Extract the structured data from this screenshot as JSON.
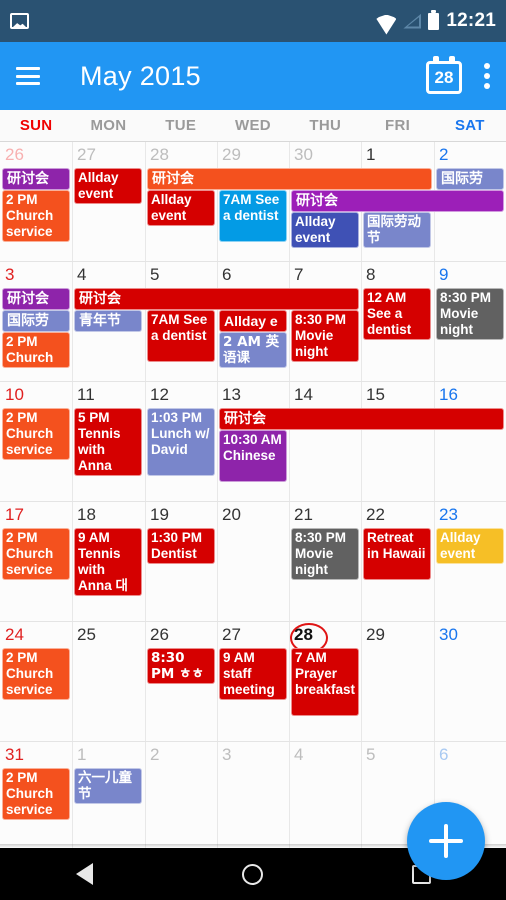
{
  "status_bar": {
    "time": "12:21",
    "icons": [
      "photo-icon",
      "wifi-icon",
      "signal-icon",
      "battery-icon"
    ]
  },
  "app_bar": {
    "menu_icon": "hamburger-menu-icon",
    "title": "May 2015",
    "today_icon_day": "28",
    "overflow_icon": "overflow-menu-icon",
    "accent_color": "#2196f3"
  },
  "weekdays": [
    {
      "label": "SUN",
      "cls": "sun"
    },
    {
      "label": "MON",
      "cls": ""
    },
    {
      "label": "TUE",
      "cls": ""
    },
    {
      "label": "WED",
      "cls": ""
    },
    {
      "label": "THU",
      "cls": ""
    },
    {
      "label": "FRI",
      "cls": ""
    },
    {
      "label": "SAT",
      "cls": "sat"
    }
  ],
  "today": "28",
  "fab": {
    "label": "+",
    "name": "add-event-fab"
  },
  "nav_bar": {
    "back": "back-button",
    "home": "home-button",
    "recents": "recents-button"
  },
  "colors": {
    "red": "#d50000",
    "orange": "#f4511e",
    "purple": "#8e24aa",
    "deep_purple": "#9c1fb8",
    "light_blue": "#039be5",
    "indigo": "#3f51b5",
    "indigo_light": "#7986cb",
    "grey": "#616161",
    "amber": "#f6bf26",
    "orange_bar": "#f4511e"
  },
  "weeks": [
    {
      "days": [
        {
          "n": "26",
          "other": true,
          "cls": "sun"
        },
        {
          "n": "27",
          "other": true,
          "cls": ""
        },
        {
          "n": "28",
          "other": true,
          "cls": ""
        },
        {
          "n": "29",
          "other": true,
          "cls": ""
        },
        {
          "n": "30",
          "other": true,
          "cls": ""
        },
        {
          "n": "1",
          "other": false,
          "cls": ""
        },
        {
          "n": "2",
          "other": false,
          "cls": "sat"
        }
      ],
      "events": [
        {
          "text": "研讨会",
          "col": 0,
          "span": 1,
          "row": 0,
          "lines": 1,
          "color": "#8e24aa",
          "bar": true,
          "cjk": true
        },
        {
          "text": "2 PM Church service",
          "col": 0,
          "span": 1,
          "row": 1,
          "lines": 3,
          "color": "#f4511e",
          "bar": false,
          "cjk": false
        },
        {
          "text": "Allday event",
          "col": 1,
          "span": 1,
          "row": 0,
          "lines": 2,
          "color": "#d50000",
          "bar": false,
          "cjk": false
        },
        {
          "text": "研讨会",
          "col": 2,
          "span": 4,
          "row": 0,
          "lines": 1,
          "color": "#f4511e",
          "bar": true,
          "cjk": true
        },
        {
          "text": "Allday event",
          "col": 2,
          "span": 1,
          "row": 1,
          "lines": 2,
          "color": "#d50000",
          "bar": false,
          "cjk": false
        },
        {
          "text": "7AM See a dentist",
          "col": 3,
          "span": 1,
          "row": 1,
          "lines": 3,
          "color": "#039be5",
          "bar": false,
          "cjk": false
        },
        {
          "text": "研讨会",
          "col": 4,
          "span": 3,
          "row": 1,
          "lines": 1,
          "color": "#9c1fb8",
          "bar": true,
          "cjk": true
        },
        {
          "text": "Allday event",
          "col": 4,
          "span": 1,
          "row": 2,
          "lines": 2,
          "color": "#3f51b5",
          "bar": false,
          "cjk": false
        },
        {
          "text": "国际劳动节",
          "col": 5,
          "span": 1,
          "row": 2,
          "lines": 2,
          "color": "#7986cb",
          "bar": false,
          "cjk": true
        },
        {
          "text": "国际劳",
          "col": 6,
          "span": 1,
          "row": 0,
          "lines": 1,
          "color": "#7986cb",
          "bar": true,
          "cjk": true
        }
      ]
    },
    {
      "days": [
        {
          "n": "3",
          "other": false,
          "cls": "sun"
        },
        {
          "n": "4",
          "other": false,
          "cls": ""
        },
        {
          "n": "5",
          "other": false,
          "cls": ""
        },
        {
          "n": "6",
          "other": false,
          "cls": ""
        },
        {
          "n": "7",
          "other": false,
          "cls": ""
        },
        {
          "n": "8",
          "other": false,
          "cls": ""
        },
        {
          "n": "9",
          "other": false,
          "cls": "sat"
        }
      ],
      "events": [
        {
          "text": "研讨会",
          "col": 0,
          "span": 1,
          "row": 0,
          "lines": 1,
          "color": "#8e24aa",
          "bar": true,
          "cjk": true
        },
        {
          "text": "国际劳",
          "col": 0,
          "span": 1,
          "row": 1,
          "lines": 1,
          "color": "#7986cb",
          "bar": true,
          "cjk": true
        },
        {
          "text": "2 PM Church",
          "col": 0,
          "span": 1,
          "row": 2,
          "lines": 2,
          "color": "#f4511e",
          "bar": false,
          "cjk": false
        },
        {
          "text": "研讨会",
          "col": 1,
          "span": 4,
          "row": 0,
          "lines": 1,
          "color": "#d50000",
          "bar": true,
          "cjk": true
        },
        {
          "text": "青年节",
          "col": 1,
          "span": 1,
          "row": 1,
          "lines": 1,
          "color": "#7986cb",
          "bar": true,
          "cjk": true
        },
        {
          "text": "7AM See a dentist",
          "col": 2,
          "span": 1,
          "row": 1,
          "lines": 3,
          "color": "#d50000",
          "bar": false,
          "cjk": false
        },
        {
          "text": "Allday e",
          "col": 3,
          "span": 1,
          "row": 1,
          "lines": 1,
          "color": "#d50000",
          "bar": true,
          "cjk": false
        },
        {
          "text": "2 AM 英语课",
          "col": 3,
          "span": 1,
          "row": 2,
          "lines": 2,
          "color": "#7986cb",
          "bar": false,
          "cjk": true
        },
        {
          "text": "8:30 PM Movie night",
          "col": 4,
          "span": 1,
          "row": 1,
          "lines": 3,
          "color": "#d50000",
          "bar": false,
          "cjk": false
        },
        {
          "text": "12 AM See a dentist",
          "col": 5,
          "span": 1,
          "row": 0,
          "lines": 3,
          "color": "#d50000",
          "bar": false,
          "cjk": false
        },
        {
          "text": "8:30 PM Movie night",
          "col": 6,
          "span": 1,
          "row": 0,
          "lines": 3,
          "color": "#616161",
          "bar": false,
          "cjk": false
        }
      ]
    },
    {
      "days": [
        {
          "n": "10",
          "other": false,
          "cls": "sun"
        },
        {
          "n": "11",
          "other": false,
          "cls": ""
        },
        {
          "n": "12",
          "other": false,
          "cls": ""
        },
        {
          "n": "13",
          "other": false,
          "cls": ""
        },
        {
          "n": "14",
          "other": false,
          "cls": ""
        },
        {
          "n": "15",
          "other": false,
          "cls": ""
        },
        {
          "n": "16",
          "other": false,
          "cls": "sat"
        }
      ],
      "events": [
        {
          "text": "2 PM Church service",
          "col": 0,
          "span": 1,
          "row": 0,
          "lines": 3,
          "color": "#f4511e",
          "bar": false,
          "cjk": false
        },
        {
          "text": "5 PM Tennis with Anna",
          "col": 1,
          "span": 1,
          "row": 0,
          "lines": 4,
          "color": "#d50000",
          "bar": false,
          "cjk": false
        },
        {
          "text": "1:03 PM Lunch w/ David",
          "col": 2,
          "span": 1,
          "row": 0,
          "lines": 4,
          "color": "#7986cb",
          "bar": false,
          "cjk": false
        },
        {
          "text": "研讨会",
          "col": 3,
          "span": 4,
          "row": 0,
          "lines": 1,
          "color": "#d50000",
          "bar": true,
          "cjk": true
        },
        {
          "text": "10:30 AM Chinese",
          "col": 3,
          "span": 1,
          "row": 1,
          "lines": 3,
          "color": "#8e24aa",
          "bar": false,
          "cjk": false
        }
      ]
    },
    {
      "days": [
        {
          "n": "17",
          "other": false,
          "cls": "sun"
        },
        {
          "n": "18",
          "other": false,
          "cls": ""
        },
        {
          "n": "19",
          "other": false,
          "cls": ""
        },
        {
          "n": "20",
          "other": false,
          "cls": ""
        },
        {
          "n": "21",
          "other": false,
          "cls": ""
        },
        {
          "n": "22",
          "other": false,
          "cls": ""
        },
        {
          "n": "23",
          "other": false,
          "cls": "sat"
        }
      ],
      "events": [
        {
          "text": "2 PM Church service",
          "col": 0,
          "span": 1,
          "row": 0,
          "lines": 3,
          "color": "#f4511e",
          "bar": false,
          "cjk": false
        },
        {
          "text": "9 AM Tennis with Anna 대",
          "col": 1,
          "span": 1,
          "row": 0,
          "lines": 4,
          "color": "#d50000",
          "bar": false,
          "cjk": false
        },
        {
          "text": "1:30 PM Dentist",
          "col": 2,
          "span": 1,
          "row": 0,
          "lines": 2,
          "color": "#d50000",
          "bar": false,
          "cjk": false
        },
        {
          "text": "8:30 PM Movie night",
          "col": 4,
          "span": 1,
          "row": 0,
          "lines": 3,
          "color": "#616161",
          "bar": false,
          "cjk": false
        },
        {
          "text": "Retreat in Hawaii",
          "col": 5,
          "span": 1,
          "row": 0,
          "lines": 3,
          "color": "#d50000",
          "bar": false,
          "cjk": false
        },
        {
          "text": "Allday event",
          "col": 6,
          "span": 1,
          "row": 0,
          "lines": 2,
          "color": "#f6bf26",
          "bar": false,
          "cjk": false
        }
      ]
    },
    {
      "days": [
        {
          "n": "24",
          "other": false,
          "cls": "sun"
        },
        {
          "n": "25",
          "other": false,
          "cls": ""
        },
        {
          "n": "26",
          "other": false,
          "cls": ""
        },
        {
          "n": "27",
          "other": false,
          "cls": ""
        },
        {
          "n": "28",
          "other": false,
          "cls": "",
          "today": true
        },
        {
          "n": "29",
          "other": false,
          "cls": ""
        },
        {
          "n": "30",
          "other": false,
          "cls": "sat"
        }
      ],
      "events": [
        {
          "text": "2 PM Church service",
          "col": 0,
          "span": 1,
          "row": 0,
          "lines": 3,
          "color": "#f4511e",
          "bar": false,
          "cjk": false
        },
        {
          "text": "8:30 PM ㅎㅎ",
          "col": 2,
          "span": 1,
          "row": 0,
          "lines": 2,
          "color": "#d50000",
          "bar": false,
          "cjk": true
        },
        {
          "text": "9 AM staff meeting",
          "col": 3,
          "span": 1,
          "row": 0,
          "lines": 3,
          "color": "#d50000",
          "bar": false,
          "cjk": false
        },
        {
          "text": "7 AM Prayer breakfast",
          "col": 4,
          "span": 1,
          "row": 0,
          "lines": 4,
          "color": "#d50000",
          "bar": false,
          "cjk": false
        }
      ]
    },
    {
      "days": [
        {
          "n": "31",
          "other": false,
          "cls": "sun"
        },
        {
          "n": "1",
          "other": true,
          "cls": ""
        },
        {
          "n": "2",
          "other": true,
          "cls": ""
        },
        {
          "n": "3",
          "other": true,
          "cls": ""
        },
        {
          "n": "4",
          "other": true,
          "cls": ""
        },
        {
          "n": "5",
          "other": true,
          "cls": ""
        },
        {
          "n": "6",
          "other": true,
          "cls": "sat"
        }
      ],
      "events": [
        {
          "text": "2 PM Church service",
          "col": 0,
          "span": 1,
          "row": 0,
          "lines": 3,
          "color": "#f4511e",
          "bar": false,
          "cjk": false
        },
        {
          "text": "六一儿童节",
          "col": 1,
          "span": 1,
          "row": 0,
          "lines": 2,
          "color": "#7986cb",
          "bar": false,
          "cjk": true
        }
      ]
    }
  ]
}
